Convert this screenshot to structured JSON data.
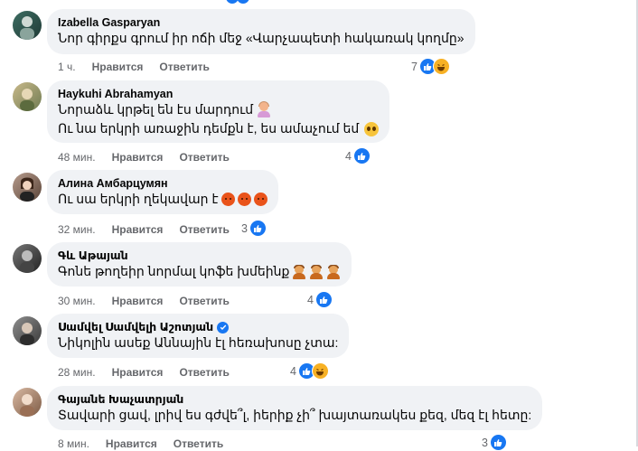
{
  "comments": [
    {
      "author": "Izabella Gasparyan",
      "lines": [
        "Նոր գիրքս գրում իր ոճի մեջ «Վարչապետի հակառակ կողմը»"
      ],
      "time": "1 ч.",
      "like_label": "Нравится",
      "reply_label": "Ответить",
      "reaction_count": "7",
      "reactions": [
        "like-icon",
        "haha-icon"
      ]
    },
    {
      "author": "Haykuhi Abrahamyan",
      "lines": [
        "Նորաձև կրթել են էս մարդում",
        "Ու նա երկրի առաջին դեմքն է, ես ամաչում եմ"
      ],
      "time": "48 мин.",
      "like_label": "Нравится",
      "reply_label": "Ответить",
      "reaction_count": "4",
      "reactions": [
        "like-icon"
      ]
    },
    {
      "author": "Алина Амбарцумян",
      "lines": [
        "Ու սա երկրի ղեկավար է"
      ],
      "time": "32 мин.",
      "like_label": "Нравится",
      "reply_label": "Ответить",
      "reaction_count": "3",
      "reactions": [
        "like-icon"
      ]
    },
    {
      "author": "Գև Աթայան",
      "lines": [
        "Գոնե թողեիր նորմալ կոֆե խմեինք"
      ],
      "time": "30 мин.",
      "like_label": "Нравится",
      "reply_label": "Ответить",
      "reaction_count": "4",
      "reactions": [
        "like-icon"
      ]
    },
    {
      "author": "Սամվել Սամվելի Աշոտյան",
      "lines": [
        "Նիկոլին ասեք Աննային էլ հեռախոսը չտա:"
      ],
      "time": "28 мин.",
      "like_label": "Нравится",
      "reply_label": "Ответить",
      "reaction_count": "4",
      "reactions": [
        "like-icon",
        "haha-icon"
      ]
    },
    {
      "author": "Գայանե Խաչատրյան",
      "lines": [
        "Տավարի ցավ, լրիվ ես գժվե՞լ, իերիք չի՞ խայտառակես քեզ, մեզ էլ հետը:"
      ],
      "time": "8 мин.",
      "like_label": "Нравится",
      "reply_label": "Ответить",
      "reaction_count": "3",
      "reactions": [
        "like-icon"
      ]
    }
  ],
  "colors": {
    "bubble": "#f0f2f5",
    "meta_text": "#65676b",
    "like_blue": "#1877f2",
    "haha_yellow": "#f7b125"
  }
}
